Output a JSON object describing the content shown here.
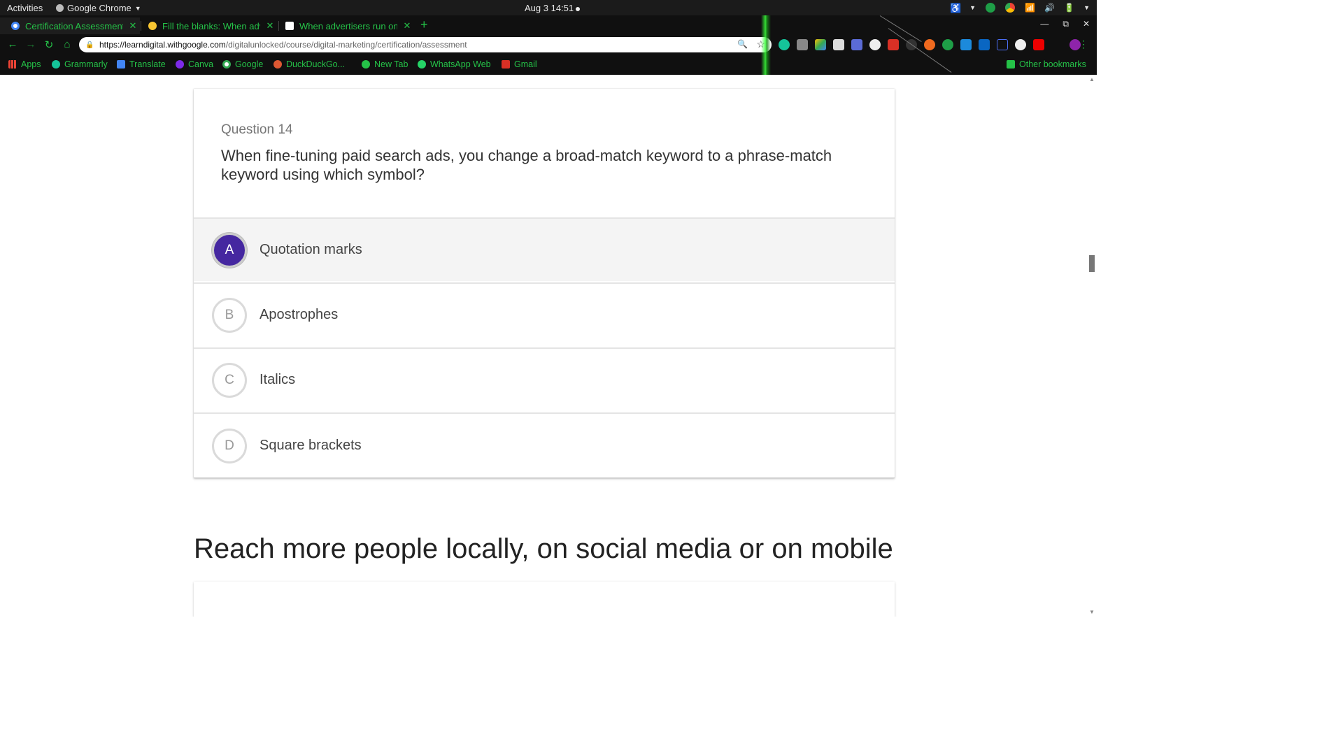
{
  "topbar": {
    "activities": "Activities",
    "app_name": "Google Chrome",
    "clock": "Aug 3  14:51"
  },
  "tabs": [
    {
      "title": "Certification Assessment",
      "favicon": "google-icon",
      "active": true
    },
    {
      "title": "Fill the blanks: When adv",
      "favicon": "bulb-icon",
      "active": false
    },
    {
      "title": "When advertisers run onl",
      "favicon": "brainly-icon",
      "active": false
    }
  ],
  "omnibox": {
    "host": "https://learndigital.withgoogle.com",
    "path": "/digitalunlocked/course/digital-marketing/certification/assessment"
  },
  "bookmarks": [
    {
      "label": "Apps",
      "icon": "apps-grid-icon"
    },
    {
      "label": "Grammarly",
      "icon": "grammarly-icon"
    },
    {
      "label": "Translate",
      "icon": "translate-icon"
    },
    {
      "label": "Canva",
      "icon": "canva-icon"
    },
    {
      "label": "Google",
      "icon": "google-icon"
    },
    {
      "label": "DuckDuckGo...",
      "icon": "duckduckgo-icon"
    },
    {
      "label": "New Tab",
      "icon": "globe-icon"
    },
    {
      "label": "WhatsApp Web",
      "icon": "whatsapp-icon"
    },
    {
      "label": "Gmail",
      "icon": "gmail-icon"
    }
  ],
  "other_bookmarks": "Other bookmarks",
  "question": {
    "label": "Question 14",
    "text": "When fine-tuning paid search ads, you change a broad-match keyword to a phrase-match keyword using which symbol?",
    "options": [
      {
        "letter": "A",
        "text": "Quotation marks",
        "selected": true
      },
      {
        "letter": "B",
        "text": "Apostrophes",
        "selected": false
      },
      {
        "letter": "C",
        "text": "Italics",
        "selected": false
      },
      {
        "letter": "D",
        "text": "Square brackets",
        "selected": false
      }
    ]
  },
  "section_heading": "Reach more people locally, on social media or on mobile",
  "colors": {
    "accent_green": "#25c248",
    "selected_option": "#4527a0",
    "chrome_dark": "#101010"
  }
}
